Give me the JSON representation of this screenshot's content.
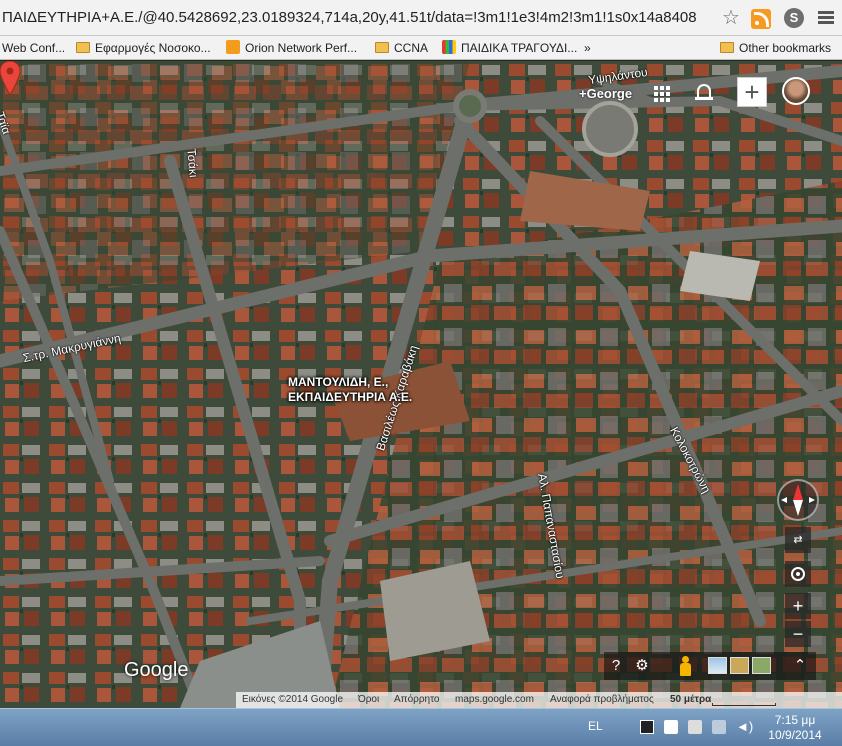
{
  "browser": {
    "url": "ΠΑΙΔΕΥΤΗΡΙΑ+Α.Ε./@40.5428692,23.0189324,714a,20y,41.51t/data=!3m1!1e3!4m2!3m1!1s0x14a8408",
    "bookmarks": [
      {
        "label": "Web Conf...",
        "icon": "none"
      },
      {
        "label": "Εφαρμογές Νοσοκο...",
        "icon": "folder-icon"
      },
      {
        "label": "Orion Network Perf...",
        "icon": "orion-icon"
      },
      {
        "label": "CCNA",
        "icon": "folder-icon"
      },
      {
        "label": "ΠΑΙΔΙΚΑ ΤΡΑΓΟΥΔΙ...",
        "icon": "kids-icon"
      }
    ],
    "other_bookmarks": "Other bookmarks",
    "more": "»"
  },
  "map": {
    "user": "+George",
    "place_name_line1": "ΜΑΝΤΟΥΛΙΔΗ, Ε.,",
    "place_name_line2": "ΕΚΠΑΙΔΕΥΤΗΡΙΑ Α.Ε.",
    "streets": {
      "tsaki": "Τσάκι",
      "makrygianni": "Σ.τρ. Μακρυγιάννη",
      "vasileos": "Βασιλέως Καραβάκη",
      "papanastasiou": "Αλ. Παπαναστασίου",
      "kolokotroni": "Κολοκοτρώνη",
      "ypsilantou": "Υψηλάντου",
      "left_edge": "Ταϊα"
    },
    "google_logo": "Google",
    "footer": {
      "imagery": "Εικόνες ©2014 Google",
      "terms": "Όροι",
      "privacy": "Απόρρητο",
      "site": "maps.google.com",
      "report": "Αναφορά προβλήματος",
      "scale": "50 μέτρα"
    },
    "controls": {
      "zoom_in": "+",
      "zoom_out": "−",
      "tilt": "⇄",
      "help": "?",
      "settings": "⚙"
    }
  },
  "taskbar": {
    "lang": "EL",
    "time": "7:15 μμ",
    "date": "10/9/2014"
  }
}
